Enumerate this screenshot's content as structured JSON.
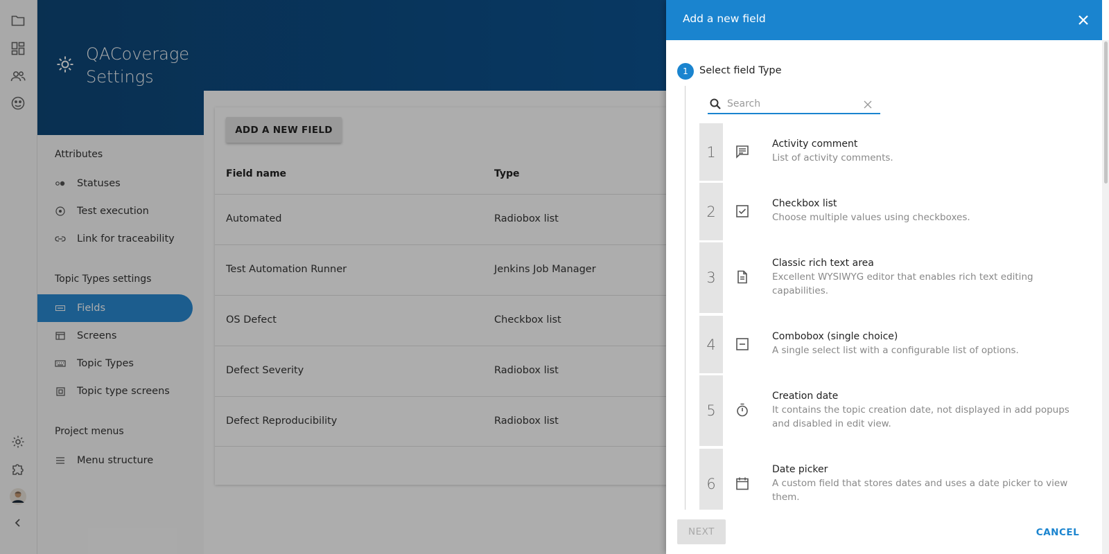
{
  "app": {
    "title": "QACoverage Settings"
  },
  "rail": {
    "top_icons": [
      "folder-icon",
      "dashboard-icon",
      "users-icon",
      "support-icon"
    ],
    "bottom_icons": [
      "settings-icon",
      "puzzle-icon",
      "avatar",
      "collapse-icon"
    ]
  },
  "sidebar": {
    "sections": [
      {
        "heading": "Attributes",
        "items": [
          {
            "label": "Statuses",
            "icon": "status-icon"
          },
          {
            "label": "Test execution",
            "icon": "target-icon"
          },
          {
            "label": "Link for traceability",
            "icon": "link-icon"
          }
        ]
      },
      {
        "heading": "Topic Types settings",
        "items": [
          {
            "label": "Fields",
            "icon": "fields-icon",
            "active": true
          },
          {
            "label": "Screens",
            "icon": "screens-icon"
          },
          {
            "label": "Topic Types",
            "icon": "keyboard-icon"
          },
          {
            "label": "Topic type screens",
            "icon": "grid-icon"
          }
        ]
      },
      {
        "heading": "Project menus",
        "items": [
          {
            "label": "Menu structure",
            "icon": "menu-icon"
          }
        ]
      }
    ]
  },
  "main": {
    "add_button": "ADD A NEW FIELD",
    "table": {
      "headers": [
        "Field name",
        "Type"
      ],
      "rows": [
        [
          "Automated",
          "Radiobox list"
        ],
        [
          "Test Automation Runner",
          "Jenkins Job Manager"
        ],
        [
          "OS Defect",
          "Checkbox list"
        ],
        [
          "Defect Severity",
          "Radiobox list"
        ],
        [
          "Defect Reproducibility",
          "Radiobox list"
        ]
      ]
    }
  },
  "drawer": {
    "title": "Add a new field",
    "step": {
      "number": "1",
      "label": "Select field Type"
    },
    "search": {
      "placeholder": "Search",
      "value": ""
    },
    "types": [
      {
        "num": "1",
        "name": "Activity comment",
        "desc": "List of activity comments.",
        "icon": "comment-icon"
      },
      {
        "num": "2",
        "name": "Checkbox list",
        "desc": "Choose multiple values using checkboxes.",
        "icon": "checkbox-icon"
      },
      {
        "num": "3",
        "name": "Classic rich text area",
        "desc": "Excellent WYSIWYG editor that enables rich text editing capabilities.",
        "icon": "document-icon"
      },
      {
        "num": "4",
        "name": "Combobox (single choice)",
        "desc": "A single select list with a configurable list of options.",
        "icon": "combobox-icon"
      },
      {
        "num": "5",
        "name": "Creation date",
        "desc": "It contains the topic creation date, not displayed in add popups and disabled in edit view.",
        "icon": "timer-icon"
      },
      {
        "num": "6",
        "name": "Date picker",
        "desc": "A custom field that stores dates and uses a date picker to view them.",
        "icon": "calendar-icon"
      }
    ],
    "next_label": "NEXT",
    "cancel_label": "CANCEL"
  },
  "colors": {
    "brand": "#1a84cf",
    "header_dark": "#0e4778",
    "active_item": "#2a8ad2"
  }
}
